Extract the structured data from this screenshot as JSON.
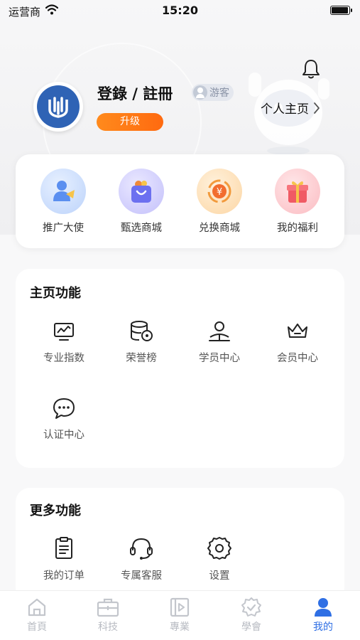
{
  "status_bar": {
    "carrier": "运营商",
    "time": "15:20"
  },
  "profile": {
    "login_title": "登錄 / 註冊",
    "guest_badge": "游客",
    "upgrade_label": "升级",
    "homepage_link": "个人主页"
  },
  "shortcuts": [
    {
      "label": "推广大使",
      "icon": "ambassador-icon"
    },
    {
      "label": "甄选商城",
      "icon": "shopping-bag-icon"
    },
    {
      "label": "兑换商城",
      "icon": "exchange-coin-icon"
    },
    {
      "label": "我的福利",
      "icon": "gift-icon"
    }
  ],
  "main_functions": {
    "title": "主页功能",
    "items": [
      {
        "label": "专业指数",
        "icon": "monitor-chart-icon"
      },
      {
        "label": "荣誉榜",
        "icon": "database-badge-icon"
      },
      {
        "label": "学员中心",
        "icon": "student-reading-icon"
      },
      {
        "label": "会员中心",
        "icon": "crown-icon"
      },
      {
        "label": "认证中心",
        "icon": "chat-bubble-icon"
      }
    ]
  },
  "more_functions": {
    "title": "更多功能",
    "items": [
      {
        "label": "我的订单",
        "icon": "clipboard-icon"
      },
      {
        "label": "专属客服",
        "icon": "headset-icon"
      },
      {
        "label": "设置",
        "icon": "gear-icon"
      }
    ]
  },
  "tabbar": {
    "items": [
      {
        "label": "首頁",
        "icon": "home-icon"
      },
      {
        "label": "科技",
        "icon": "briefcase-icon"
      },
      {
        "label": "專業",
        "icon": "video-icon"
      },
      {
        "label": "學會",
        "icon": "shield-check-icon"
      },
      {
        "label": "我的",
        "icon": "user-icon"
      }
    ],
    "active_index": 4
  },
  "colors": {
    "accent": "#2f6fe4",
    "upgrade": "#ff7a15",
    "avatar_blue": "#2f63b5"
  }
}
